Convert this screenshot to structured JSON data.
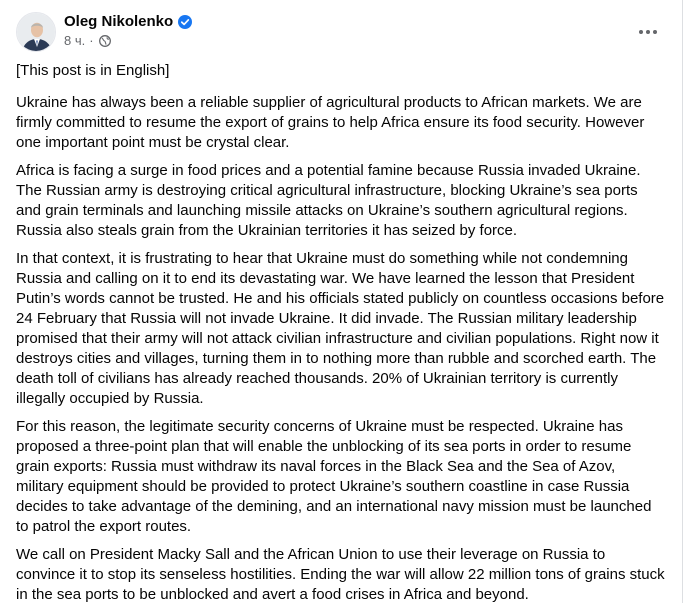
{
  "author": {
    "name": "Oleg Nikolenko",
    "time": "8 ч."
  },
  "icons": {
    "verified": "verified-badge-icon",
    "globe": "globe-icon",
    "more": "more-options-icon"
  },
  "colors": {
    "verified": "#1877f2",
    "secondary_text": "#65676b"
  },
  "post": {
    "note": "[This post is in English]",
    "paragraphs": [
      "Ukraine has always been a reliable supplier of agricultural products to African markets. We are firmly committed to resume the export of grains to help Africa ensure its food security. However one important point must be crystal clear.",
      "Africa is facing a surge in food prices and a potential famine because Russia invaded Ukraine. The Russian army is destroying critical agricultural infrastructure, blocking Ukraine’s sea ports and grain terminals and launching missile attacks on Ukraine’s southern agricultural regions. Russia also steals grain from the Ukrainian territories it has seized by force.",
      "In that context, it is frustrating to hear that Ukraine must do something while not condemning Russia and calling on it to end its devastating war. We have learned the lesson that President Putin’s words cannot be trusted. He and his officials stated publicly on countless occasions before 24 February that Russia will not invade Ukraine. It did invade. The Russian military leadership promised that their army will not attack civilian infrastructure and civilian populations. Right now it destroys cities and villages, turning them in to nothing more than rubble and scorched earth. The death toll of civilians has already reached thousands. 20% of Ukrainian territory is currently illegally occupied by Russia.",
      "For this reason, the legitimate security concerns of Ukraine must be respected. Ukraine has proposed a three-point plan that will enable the unblocking of its sea ports in order to resume grain exports: Russia must withdraw its naval forces in the Black Sea and the Sea of Azov, military equipment should be provided to protect Ukraine’s southern coastline in case Russia decides to take advantage of the demining, and an international navy mission must be launched to patrol the export routes.",
      "We call on President Macky Sall and the African Union to use their leverage on Russia to convince it to stop its senseless hostilities. Ending the war will allow 22 million tons of grains stuck in the sea ports to be unblocked and avert a food crises in Africa and beyond."
    ]
  }
}
